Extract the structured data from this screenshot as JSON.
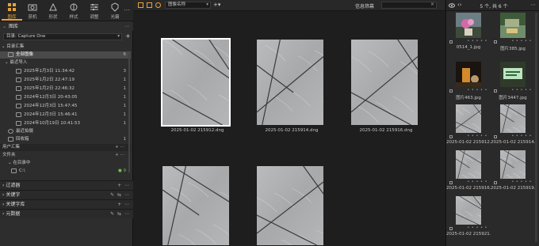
{
  "tool_tabs": [
    {
      "label": "图库",
      "icon": "library-icon",
      "active": true
    },
    {
      "label": "获机",
      "icon": "camera-icon",
      "active": false
    },
    {
      "label": "形状",
      "icon": "shape-icon",
      "active": false
    },
    {
      "label": "样式",
      "icon": "style-icon",
      "active": false
    },
    {
      "label": "调整",
      "icon": "adjust-icon",
      "active": false
    },
    {
      "label": "光霸",
      "icon": "lens-icon",
      "active": false
    }
  ],
  "library": {
    "title": "图库",
    "catalog": "目录: Capture One",
    "sections": {
      "catalog_collections": "目录汇集",
      "all_images": {
        "label": "全部图像",
        "count": "6"
      },
      "recent_imports": "最近导入",
      "imports": [
        {
          "label": "2025年1月3日 11:34:42",
          "count": "3"
        },
        {
          "label": "2025年1月2日 22:47:19",
          "count": "1"
        },
        {
          "label": "2025年1月2日 22:46:32",
          "count": "1"
        },
        {
          "label": "2024年12月3日 20:43:05",
          "count": "1"
        },
        {
          "label": "2024年12月3日 15:47:45",
          "count": "1"
        },
        {
          "label": "2024年12月3日 15:46:41",
          "count": "1"
        },
        {
          "label": "2024年10月19日 10:41:53",
          "count": "1"
        }
      ],
      "recent_captures": "最近拍摄",
      "trash": {
        "label": "回收箱",
        "count": "1"
      },
      "user_collections": "用户汇集",
      "folders": "文件夹",
      "in_catalog": "在目录中",
      "drive": {
        "label": "C:\\",
        "count": "9"
      }
    }
  },
  "bottom_sections": [
    "过滤器",
    "关键字",
    "关键字库",
    "元数据"
  ],
  "viewer": {
    "sort_label": "图像名称",
    "filter_label": "信息筛幕",
    "images": [
      {
        "name": "2025-01-02 215912.dng",
        "selected": true
      },
      {
        "name": "2025-01-02 215914.dng",
        "selected": false
      },
      {
        "name": "2025-01-02 215916.dng",
        "selected": false
      },
      {
        "name": "",
        "selected": false
      },
      {
        "name": "",
        "selected": false
      }
    ]
  },
  "browser": {
    "count_label": "5 个, 共 6 个",
    "thumbs": [
      {
        "name": "0514_1.jpg",
        "kind": "flowers"
      },
      {
        "name": "图片385.jpg",
        "kind": "boat"
      },
      {
        "name": "图片463.jpg",
        "kind": "drink"
      },
      {
        "name": "图片3447.jpg",
        "kind": "sign"
      },
      {
        "name": "2025-01-02 215912...",
        "kind": "marble"
      },
      {
        "name": "2025-01-02 215914...",
        "kind": "marble"
      },
      {
        "name": "2025-01-02 215916...",
        "kind": "marble"
      },
      {
        "name": "2025-01-02 215919...",
        "kind": "marble"
      },
      {
        "name": "2025-01-02 215921...",
        "kind": "marble"
      }
    ]
  },
  "colors": {
    "accent": "#e8a33c",
    "panel": "#2d2d2d",
    "background": "#1e1e1e"
  }
}
